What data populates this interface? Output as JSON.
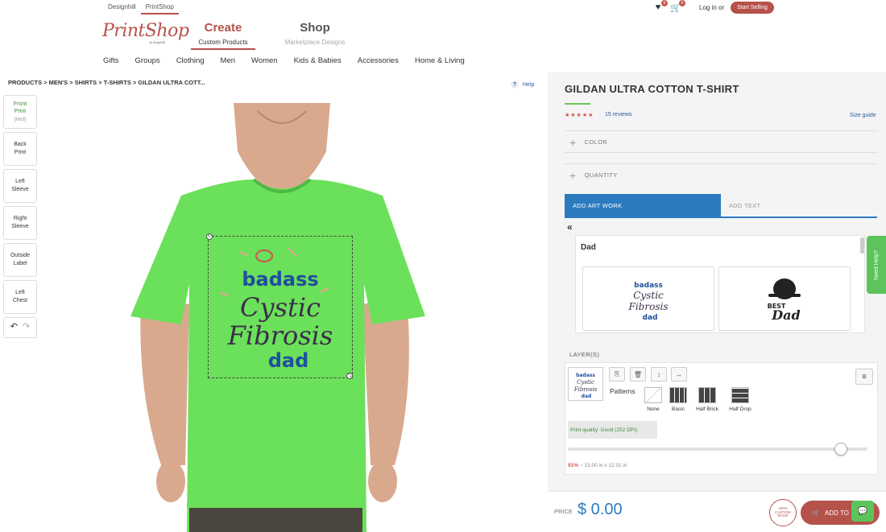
{
  "header": {
    "top_links": [
      "Designhill",
      "PrintShop"
    ],
    "logo": "PrintShop",
    "logo_sub": "by designhill",
    "create": {
      "title": "Create",
      "sub": "Custom Products"
    },
    "shop": {
      "title": "Shop",
      "sub": "Marketplace Designs"
    },
    "wishlist_count": "0",
    "cart_count": "0",
    "login": "Log in",
    "or": "or",
    "start_selling": "Start Selling"
  },
  "categories": [
    "Gifts",
    "Groups",
    "Clothing",
    "Men",
    "Women",
    "Kids & Babies",
    "Accessories",
    "Home & Living"
  ],
  "breadcrumb": "PRODUCTS > MEN'S > SHIRTS > T-SHIRTS > GILDAN ULTRA COTT...",
  "help": "Help",
  "tools": {
    "front": {
      "l1": "Front",
      "l2": "Print",
      "incl": "(Incl)"
    },
    "back": {
      "l1": "Back",
      "l2": "Print"
    },
    "left_sleeve": {
      "l1": "Left",
      "l2": "Sleeve"
    },
    "right_sleeve": {
      "l1": "Right",
      "l2": "Sleeve"
    },
    "outside_label": {
      "l1": "Outside",
      "l2": "Label"
    },
    "left_chest": {
      "l1": "Left",
      "l2": "Chest"
    }
  },
  "design": {
    "line1": "badass",
    "line2": "Cystic",
    "line3": "Fibrosis",
    "line4": "dad"
  },
  "product": {
    "title": "GILDAN ULTRA COTTON T-SHIRT",
    "stars": "★★★★★",
    "reviews": "15 reviews",
    "size_guide": "Size guide",
    "color_label": "COLOR",
    "quantity_label": "QUANTITY",
    "shirt_color": "#6be05a"
  },
  "tabs": {
    "artwork": "ADD ART WORK",
    "text": "ADD TEXT"
  },
  "artwork": {
    "back": "«",
    "category": "Dad",
    "card2_l1": "BEST",
    "card2_l2": "Dad"
  },
  "need_help": "Need Help?",
  "layers": {
    "label": "LAYER(S)",
    "patterns_label": "Patterns",
    "patterns": [
      "None",
      "Basic",
      "Half Brick",
      "Half Drop"
    ],
    "quality": "Print quality: Good (252 DPI)",
    "scale_percent": "91%",
    "dimensions": "~ 13.00 in x 12.01 in",
    "slider_value": 91
  },
  "footer": {
    "price_label": "PRICE",
    "price": "$ 0.00",
    "badge": "100% CUSTOM MADE",
    "add_to_cart": "ADD TO"
  }
}
